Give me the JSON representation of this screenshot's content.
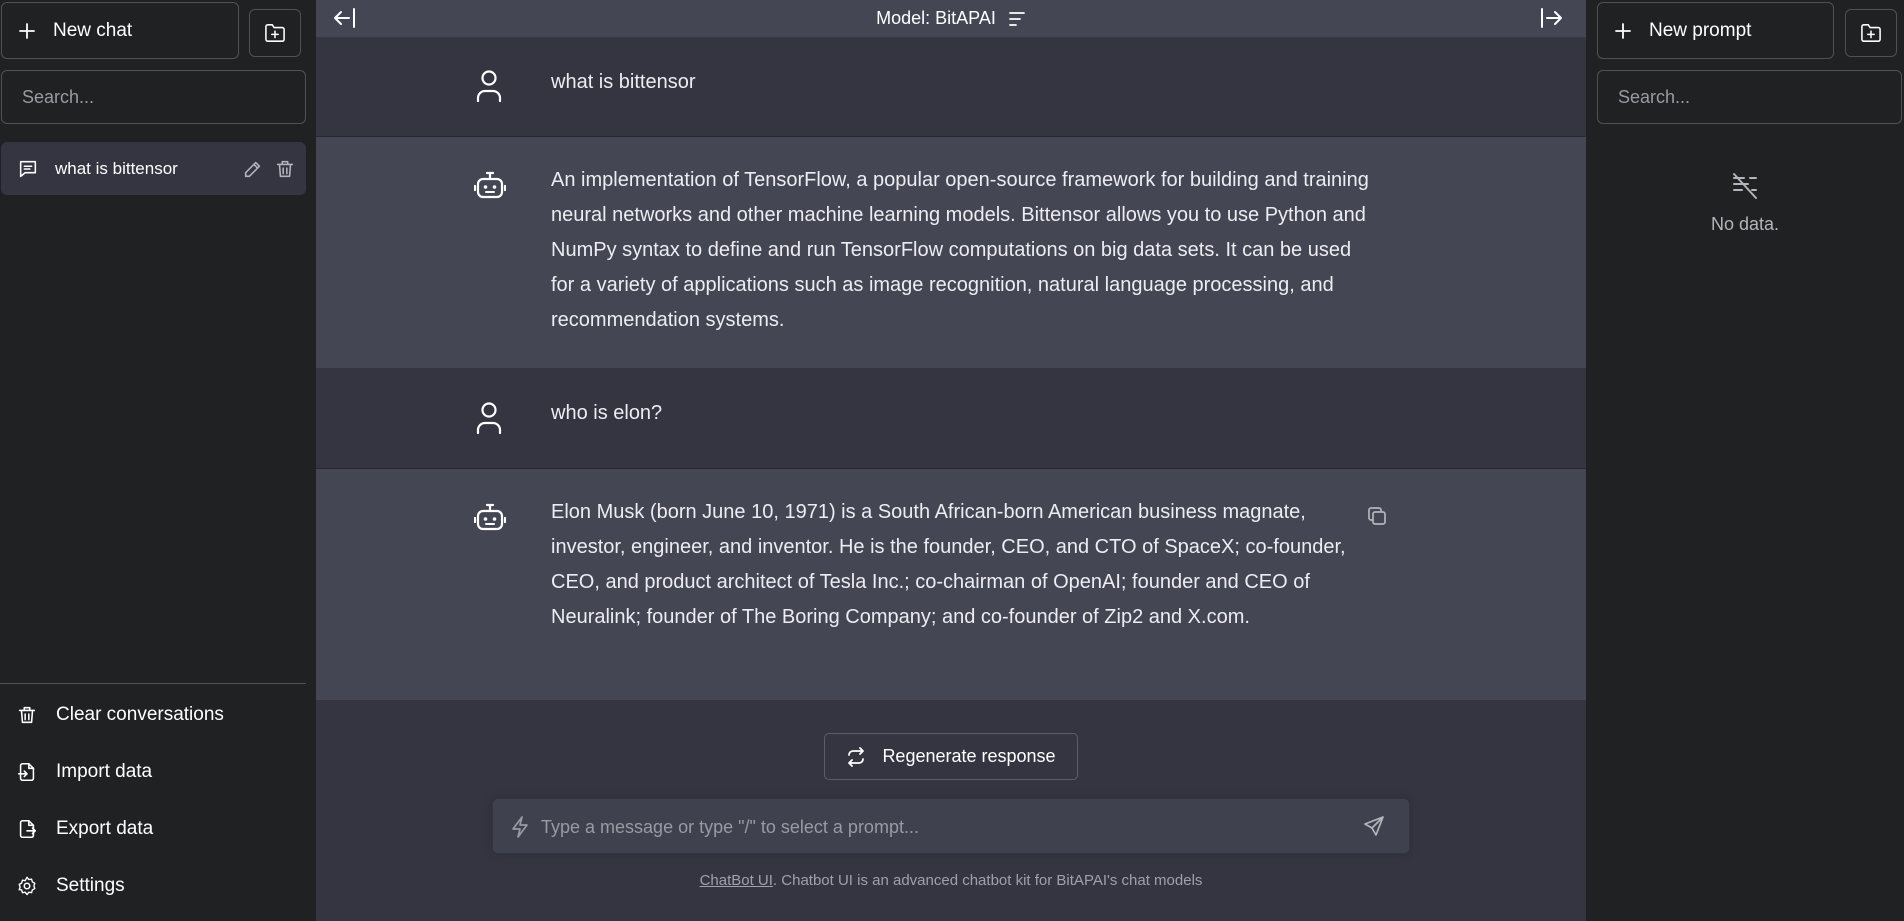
{
  "left_sidebar": {
    "new_chat_label": "New chat",
    "search_placeholder": "Search...",
    "conversations": [
      {
        "title": "what is bittensor"
      }
    ],
    "bottom": {
      "clear": "Clear conversations",
      "import": "Import data",
      "export": "Export data",
      "settings": "Settings"
    }
  },
  "topbar": {
    "model_label": "Model: BitAPAI"
  },
  "messages": [
    {
      "role": "user",
      "text": "what is bittensor"
    },
    {
      "role": "assistant",
      "text": "An implementation of TensorFlow, a popular open-source framework for building and training neural networks and other machine learning models. Bittensor allows you to use Python and NumPy syntax to define and run TensorFlow computations on big data sets. It can be used for a variety of applications such as image recognition, natural language processing, and recommendation systems."
    },
    {
      "role": "user",
      "text": "who is elon?"
    },
    {
      "role": "assistant",
      "text": "Elon Musk (born June 10, 1971) is a South African-born American business magnate, investor, engineer, and inventor. He is the founder, CEO, and CTO of SpaceX; co-founder, CEO, and product architect of Tesla Inc.; co-chairman of OpenAI; founder and CEO of Neuralink; founder of The Boring Company; and co-founder of Zip2 and X.com."
    }
  ],
  "composer": {
    "regenerate_label": "Regenerate response",
    "placeholder": "Type a message or type \"/\" to select a prompt..."
  },
  "footer": {
    "link_text": "ChatBot UI",
    "text": ". Chatbot UI is an advanced chatbot kit for BitAPAI's chat models"
  },
  "right_sidebar": {
    "new_prompt_label": "New prompt",
    "search_placeholder": "Search...",
    "empty_text": "No data."
  },
  "colors": {
    "sidebar_bg": "#202123",
    "main_bg": "#343541",
    "assistant_bg": "#444654",
    "input_bg": "#40414f"
  }
}
